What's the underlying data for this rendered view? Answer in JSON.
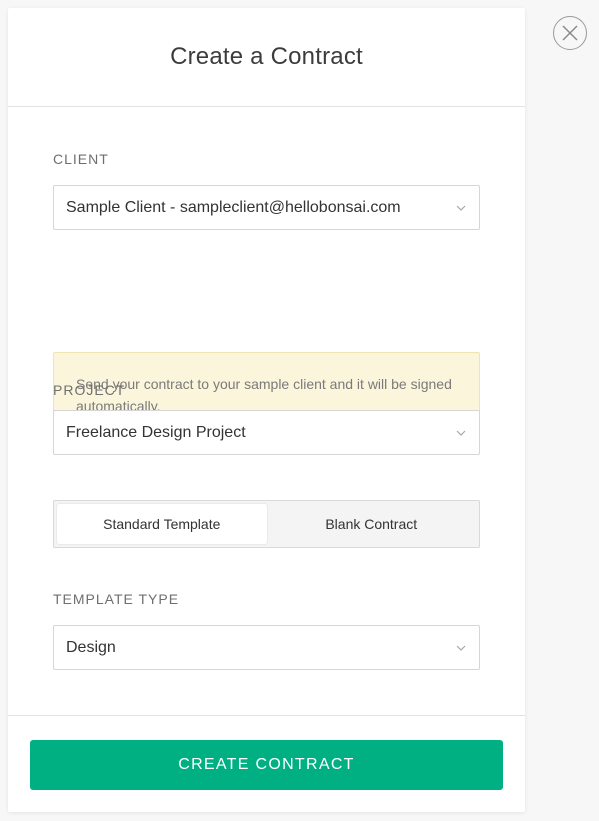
{
  "modal": {
    "title": "Create a Contract"
  },
  "client": {
    "label": "CLIENT",
    "selected": "Sample Client - sampleclient@hellobonsai.com",
    "notice": "Send your contract to your sample client and it will be signed automatically."
  },
  "project": {
    "label": "PROJECT",
    "selected": "Freelance Design Project"
  },
  "template_mode": {
    "options": [
      "Standard Template",
      "Blank Contract"
    ],
    "active": "Standard Template"
  },
  "template_type": {
    "label": "TEMPLATE TYPE",
    "selected": "Design"
  },
  "footer": {
    "create_label": "CREATE CONTRACT"
  },
  "colors": {
    "primary": "#00b083",
    "notice_bg": "#fbf5dc"
  },
  "icons": {
    "close": "close-icon",
    "dropdown": "chevron-down-icon"
  }
}
